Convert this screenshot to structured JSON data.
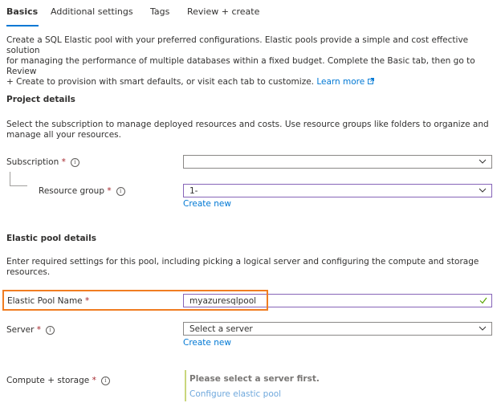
{
  "tabs": [
    {
      "label": "Basics"
    },
    {
      "label": "Additional settings"
    },
    {
      "label": "Tags"
    },
    {
      "label": "Review + create"
    }
  ],
  "intro": {
    "line1": "Create a SQL Elastic pool with your preferred configurations. Elastic pools provide a simple and cost effective solution",
    "line2": "for managing the performance of multiple databases within a fixed budget. Complete the Basic tab, then go to Review",
    "line3": "+ Create to provision with smart defaults, or visit each tab to customize.",
    "learn_more": "Learn more"
  },
  "project": {
    "title": "Project details",
    "desc_line1": "Select the subscription to manage deployed resources and costs. Use resource groups like folders to organize and",
    "desc_line2": "manage all your resources.",
    "subscription_label": "Subscription",
    "subscription_value": "",
    "resource_group_label": "Resource group",
    "resource_group_value": "1-",
    "create_new": "Create new"
  },
  "pool": {
    "title": "Elastic pool details",
    "desc_line1": "Enter required settings for this pool, including picking a logical server and configuring the compute and storage",
    "desc_line2": "resources.",
    "name_label": "Elastic Pool Name",
    "name_value": "myazuresqlpool",
    "server_label": "Server",
    "server_value": "Select a server",
    "create_new": "Create new",
    "compute_label": "Compute + storage",
    "compute_message": "Please select a server first.",
    "compute_link": "Configure elastic pool"
  },
  "required_marker": "*",
  "colors": {
    "accent": "#0078d4",
    "required": "#a4262c",
    "highlight": "#f07d22",
    "valid": "#57a300"
  }
}
